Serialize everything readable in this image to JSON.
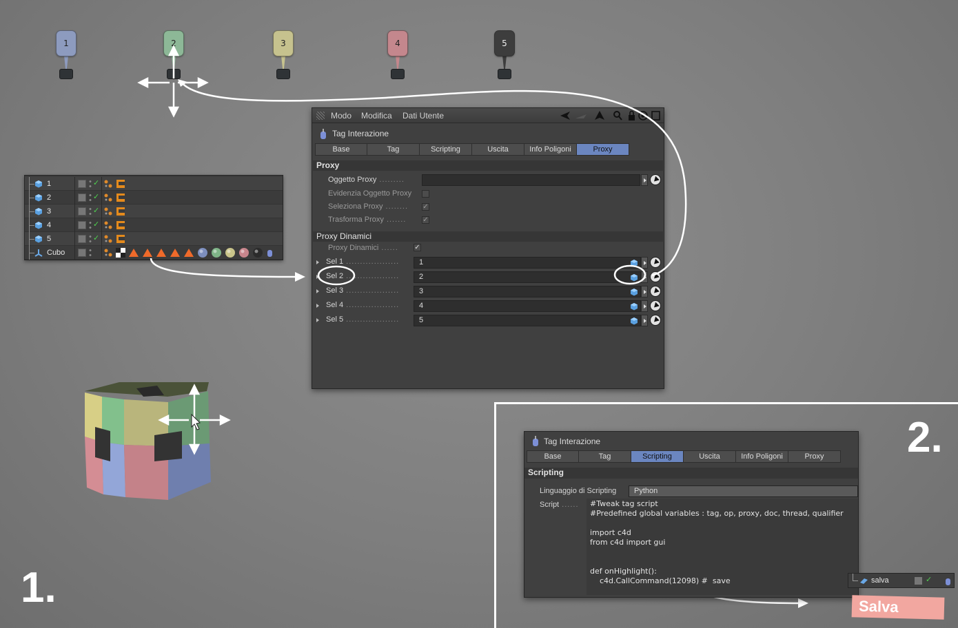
{
  "markers": [
    {
      "label": "1",
      "color": "#8d9bbf"
    },
    {
      "label": "2",
      "color": "#8db897"
    },
    {
      "label": "3",
      "color": "#c6c28e"
    },
    {
      "label": "4",
      "color": "#c4878d"
    },
    {
      "label": "5",
      "color": "#3d3d3d"
    }
  ],
  "object_manager": {
    "rows": [
      {
        "name": "1"
      },
      {
        "name": "2"
      },
      {
        "name": "3"
      },
      {
        "name": "4"
      },
      {
        "name": "5"
      },
      {
        "name": "Cubo"
      }
    ],
    "cube_material_colors": [
      "#7d8fbf",
      "#7fb488",
      "#c9c48a",
      "#c8858c",
      "#2b2b2b"
    ]
  },
  "panel1": {
    "menu": {
      "modo": "Modo",
      "modifica": "Modifica",
      "dati_utente": "Dati Utente"
    },
    "tag_title": "Tag Interazione",
    "tabs": [
      "Base",
      "Tag",
      "Scripting",
      "Uscita",
      "Info Poligoni",
      "Proxy"
    ],
    "active_tab": "Proxy",
    "proxy_section": "Proxy",
    "oggetto_proxy": "Oggetto Proxy",
    "evidenzia": "Evidenzia Oggetto Proxy",
    "seleziona": "Seleziona Proxy",
    "trasforma": "Trasforma Proxy",
    "dyn_section": "Proxy Dinamici",
    "proxy_dinamici": "Proxy Dinamici",
    "sel_rows": [
      {
        "label": "Sel 1",
        "value": "1"
      },
      {
        "label": "Sel 2",
        "value": "2"
      },
      {
        "label": "Sel 3",
        "value": "3"
      },
      {
        "label": "Sel 4",
        "value": "4"
      },
      {
        "label": "Sel 5",
        "value": "5"
      }
    ]
  },
  "panel2": {
    "tag_title": "Tag Interazione",
    "tabs": [
      "Base",
      "Tag",
      "Scripting",
      "Uscita",
      "Info Poligoni",
      "Proxy"
    ],
    "active_tab": "Scripting",
    "section": "Scripting",
    "lang_label": "Linguaggio di Scripting",
    "lang_value": "Python",
    "script_label": "Script",
    "script_lines": [
      "#Tweak tag script",
      "#Predefined global variables : tag, op, proxy, doc, thread, qualifier",
      "",
      "import c4d",
      "from c4d import gui",
      "",
      "",
      "def onHighlight():",
      "    c4d.CallCommand(12098) #  save"
    ]
  },
  "salva_obj": {
    "name": "salva"
  },
  "salva_label": "Salva",
  "step1": "1.",
  "step2": "2."
}
